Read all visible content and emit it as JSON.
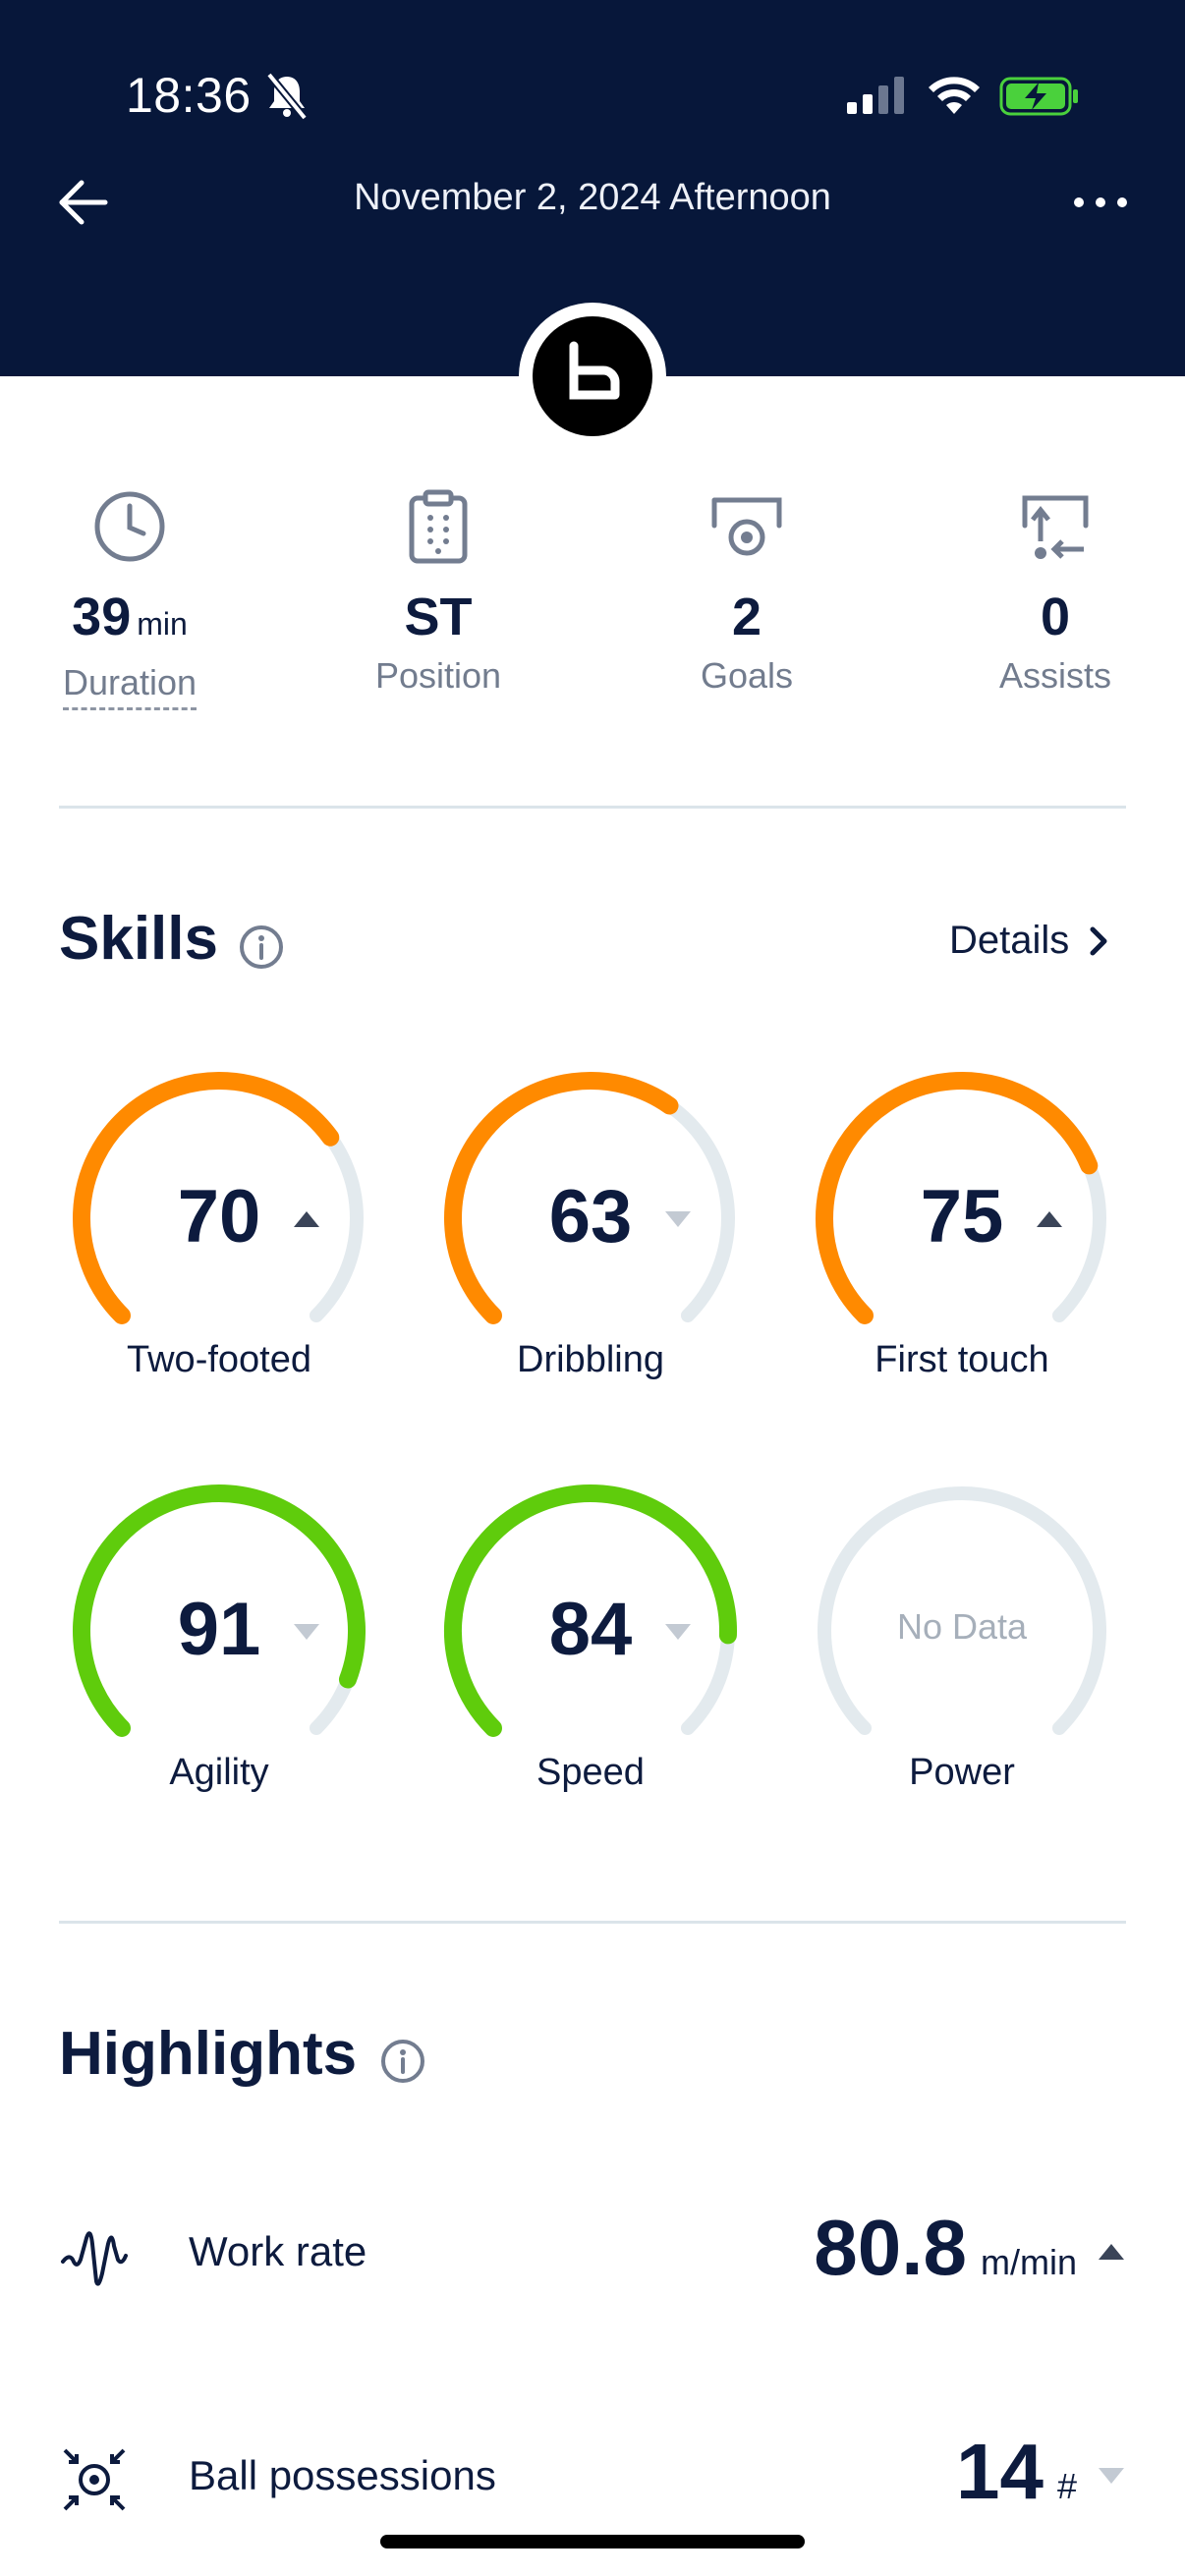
{
  "status_bar": {
    "time": "18:36"
  },
  "header": {
    "title": "November 2, 2024 Afternoon"
  },
  "stats": [
    {
      "value": "39",
      "unit": "min",
      "label": "Duration"
    },
    {
      "value": "ST",
      "label": "Position"
    },
    {
      "value": "2",
      "label": "Goals"
    },
    {
      "value": "0",
      "label": "Assists"
    }
  ],
  "skills": {
    "title": "Skills",
    "details_label": "Details",
    "items": [
      {
        "label": "Two-footed",
        "score": "70",
        "trend": "up",
        "color": "#ff8a00"
      },
      {
        "label": "Dribbling",
        "score": "63",
        "trend": "down",
        "color": "#ff8a00"
      },
      {
        "label": "First touch",
        "score": "75",
        "trend": "up",
        "color": "#ff8a00"
      },
      {
        "label": "Agility",
        "score": "91",
        "trend": "down",
        "color": "#5fcc0c"
      },
      {
        "label": "Speed",
        "score": "84",
        "trend": "down",
        "color": "#5fcc0c"
      },
      {
        "label": "Power",
        "no_data": "No Data"
      }
    ]
  },
  "highlights": {
    "title": "Highlights",
    "items": [
      {
        "label": "Work rate",
        "value": "80.8",
        "unit": "m/min",
        "trend": "up",
        "icon": "wave-icon"
      },
      {
        "label": "Ball possessions",
        "value": "14",
        "unit": "#",
        "trend": "down",
        "icon": "ball-possession-icon"
      }
    ]
  },
  "colors": {
    "header_bg": "#07173a",
    "orange": "#ff8a00",
    "green": "#5fcc0c",
    "track": "#e3eaee"
  }
}
